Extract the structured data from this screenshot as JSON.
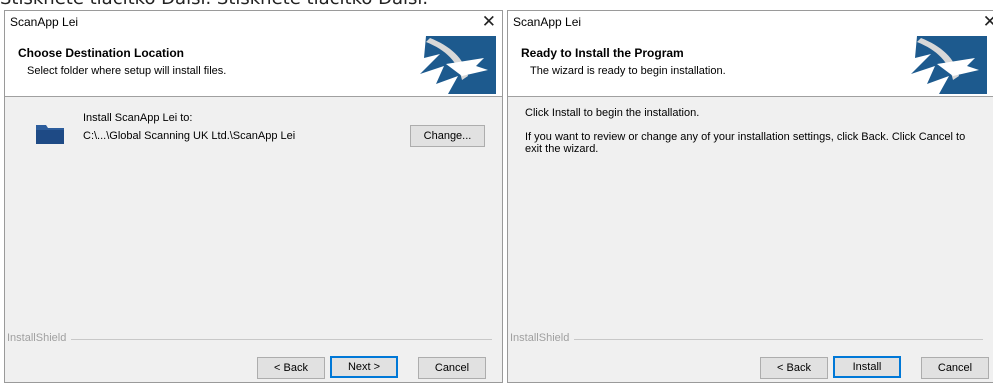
{
  "caption": "Stisknete tlacitko Dalsi. Stisknete tlacitko Dalsi.",
  "window1": {
    "title": "ScanApp Lei",
    "close": "✕",
    "header_title": "Choose Destination Location",
    "header_subtitle": "Select folder where setup will install files.",
    "install_label": "Install ScanApp Lei to:",
    "install_path": "C:\\...\\Global Scanning UK Ltd.\\ScanApp Lei",
    "change_button": "Change...",
    "brand": "InstallShield",
    "back_button": "< Back",
    "next_button": "Next >",
    "cancel_button": "Cancel"
  },
  "window2": {
    "title": "ScanApp Lei",
    "close": "✕",
    "header_title": "Ready to Install the Program",
    "header_subtitle": "The wizard is ready to begin installation.",
    "line1": "Click Install to begin the installation.",
    "line2": "If you want to review or change any of your installation settings, click Back. Click Cancel to exit the wizard.",
    "brand": "InstallShield",
    "back_button": "< Back",
    "install_button": "Install",
    "cancel_button": "Cancel"
  },
  "colors": {
    "accent": "#0078d7",
    "logo_blue": "#1d5a8e",
    "folder_blue": "#2c5d9c"
  }
}
